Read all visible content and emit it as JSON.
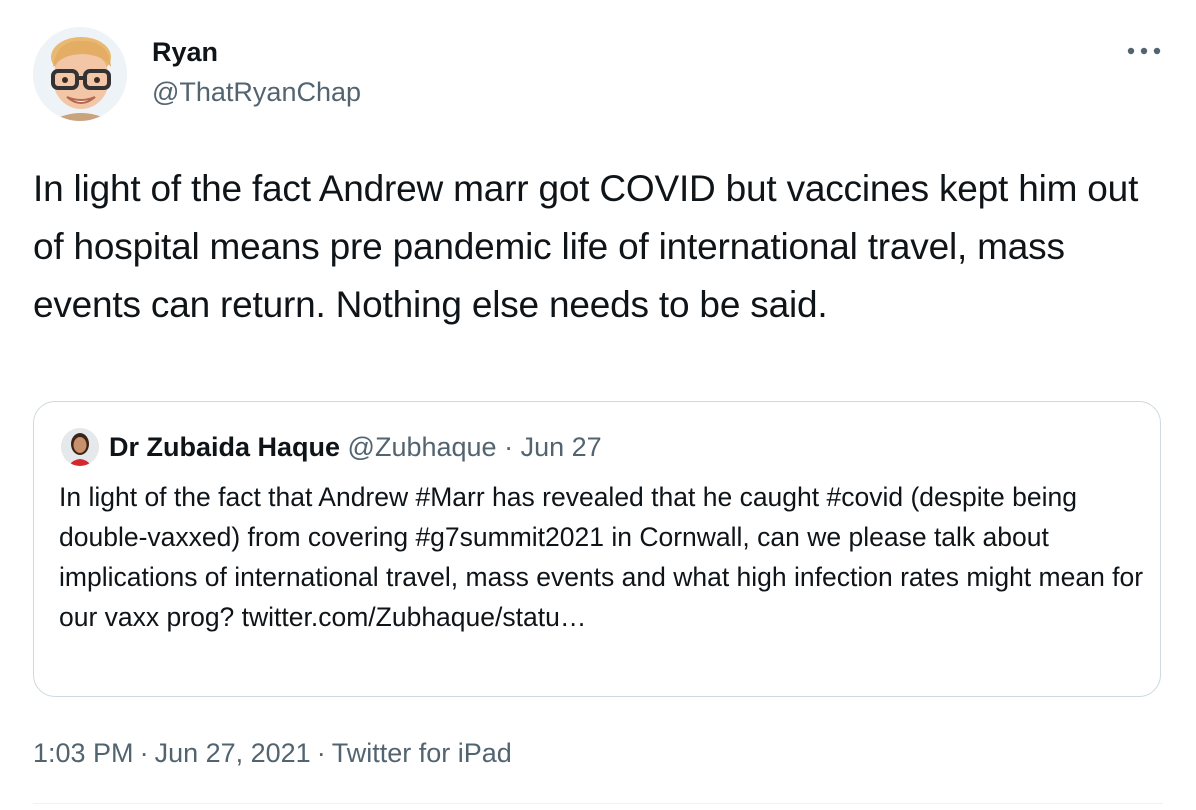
{
  "author": {
    "display_name": "Ryan",
    "handle": "@ThatRyanChap",
    "avatar_icon": "memoji-avatar-icon"
  },
  "more_icon": "more-horizontal-icon",
  "tweet": {
    "text": "In light of the fact Andrew marr got COVID but vaccines kept him out of hospital means pre pandemic life of international travel, mass events can return. Nothing else needs to be said."
  },
  "quoted": {
    "display_name": "Dr Zubaida Haque",
    "handle": "@Zubhaque",
    "separator": "·",
    "date": "Jun 27",
    "text": "In light of the fact that Andrew #Marr has revealed that he caught #covid (despite being double-vaxxed) from covering #g7summit2021 in Cornwall, can we please talk about implications of international travel, mass events and what high infection rates might mean for our vaxx prog? twitter.com/Zubhaque/statu…"
  },
  "footer": {
    "time": "1:03 PM",
    "date": "Jun 27, 2021",
    "source": "Twitter for iPad",
    "separator": "·"
  },
  "colors": {
    "primary_text": "#0f1419",
    "secondary_text": "#536471",
    "border": "#cfd9de"
  }
}
